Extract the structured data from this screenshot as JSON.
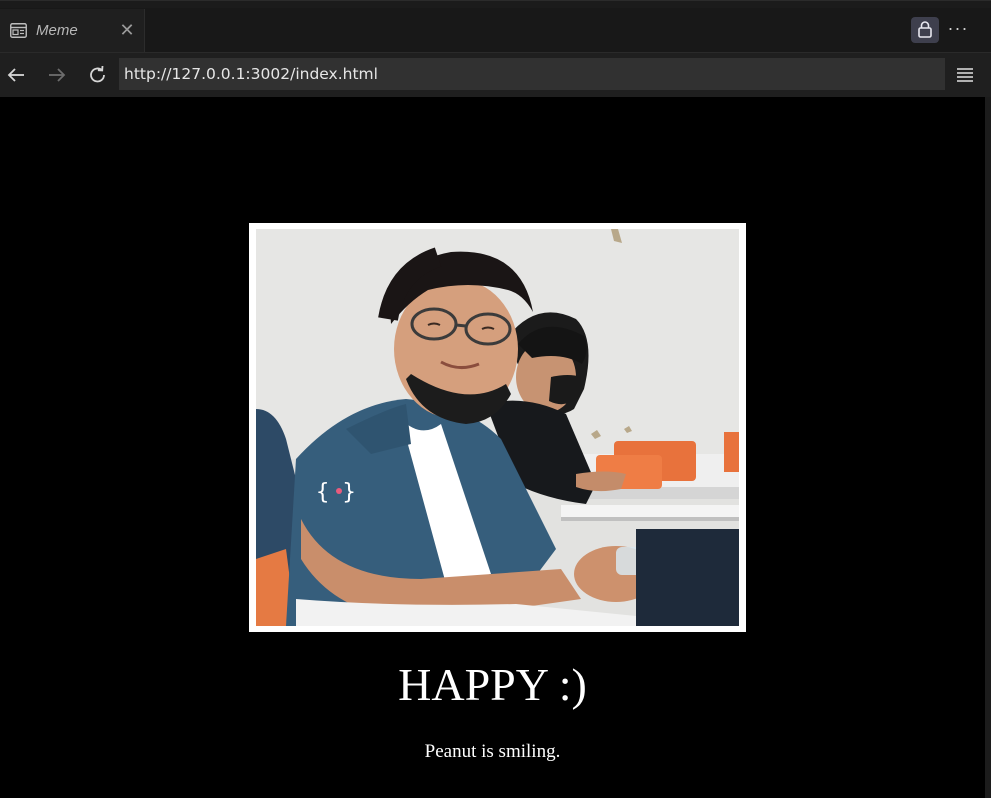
{
  "browser": {
    "tab": {
      "title": "Meme",
      "icon": "browser-page-icon",
      "close_icon": "close-icon",
      "close_glyph": "✕"
    },
    "toolbar": {
      "lock_icon": "lock-icon",
      "more_icon": "more-icon",
      "more_glyph": "···",
      "back_icon": "back-arrow-icon",
      "forward_icon": "forward-arrow-icon",
      "reload_icon": "reload-icon",
      "menu_icon": "hamburger-menu-icon"
    },
    "address_bar": {
      "url": "http://127.0.0.1:3002/index.html"
    }
  },
  "page": {
    "image": {
      "description_icon": "photo"
    },
    "headline": "HAPPY :)",
    "caption": "Peanut is smiling."
  },
  "colors": {
    "page_background": "#000000",
    "chrome_background": "#1f1f1f",
    "url_field_background": "#313131",
    "text": "#ffffff",
    "lock_button": "#3e3f4d"
  }
}
